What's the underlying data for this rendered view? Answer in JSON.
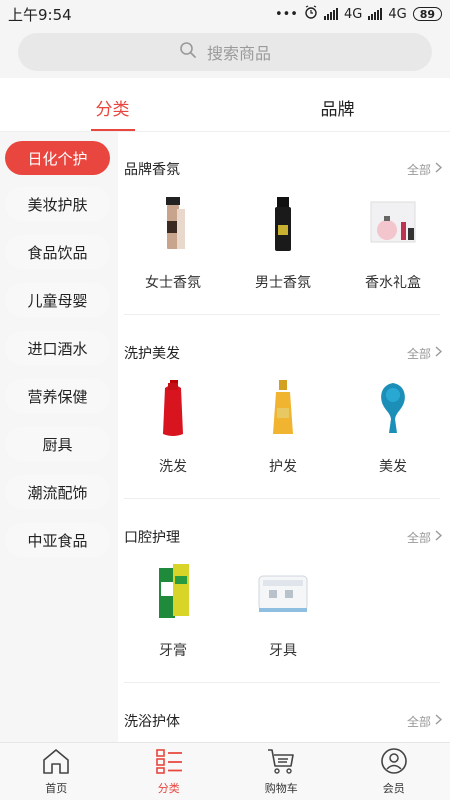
{
  "status_bar": {
    "time": "上午9:54",
    "dots": "•••",
    "network1": "4G",
    "network2": "4G",
    "battery": "89"
  },
  "search": {
    "placeholder": "搜索商品"
  },
  "tabs": [
    {
      "label": "分类",
      "active": true
    },
    {
      "label": "品牌",
      "active": false
    }
  ],
  "sidebar": {
    "items": [
      {
        "label": "日化个护",
        "active": true
      },
      {
        "label": "美妆护肤"
      },
      {
        "label": "食品饮品"
      },
      {
        "label": "儿童母婴"
      },
      {
        "label": "进口酒水"
      },
      {
        "label": "营养保健"
      },
      {
        "label": "厨具"
      },
      {
        "label": "潮流配饰"
      },
      {
        "label": "中亚食品"
      }
    ]
  },
  "sections": [
    {
      "title": "品牌香氛",
      "more": "全部",
      "products": [
        {
          "label": "女士香氛",
          "icon": "perfume-bottle-icon"
        },
        {
          "label": "男士香氛",
          "icon": "men-perfume-icon"
        },
        {
          "label": "香水礼盒",
          "icon": "perfume-giftbox-icon"
        }
      ]
    },
    {
      "title": "洗护美发",
      "more": "全部",
      "products": [
        {
          "label": "洗发",
          "icon": "shampoo-bottle-icon"
        },
        {
          "label": "护发",
          "icon": "hair-oil-icon"
        },
        {
          "label": "美发",
          "icon": "hair-brush-icon"
        }
      ]
    },
    {
      "title": "口腔护理",
      "more": "全部",
      "products": [
        {
          "label": "牙膏",
          "icon": "toothpaste-icon"
        },
        {
          "label": "牙具",
          "icon": "toothbrush-holder-icon"
        }
      ]
    },
    {
      "title": "洗浴护体",
      "more": "全部",
      "products": []
    }
  ],
  "bottom_nav": [
    {
      "label": "首页",
      "icon": "home-icon"
    },
    {
      "label": "分类",
      "icon": "category-icon",
      "active": true
    },
    {
      "label": "购物车",
      "icon": "cart-icon"
    },
    {
      "label": "会员",
      "icon": "member-icon"
    }
  ],
  "colors": {
    "accent": "#e8463f",
    "background": "#f5f5f5"
  }
}
